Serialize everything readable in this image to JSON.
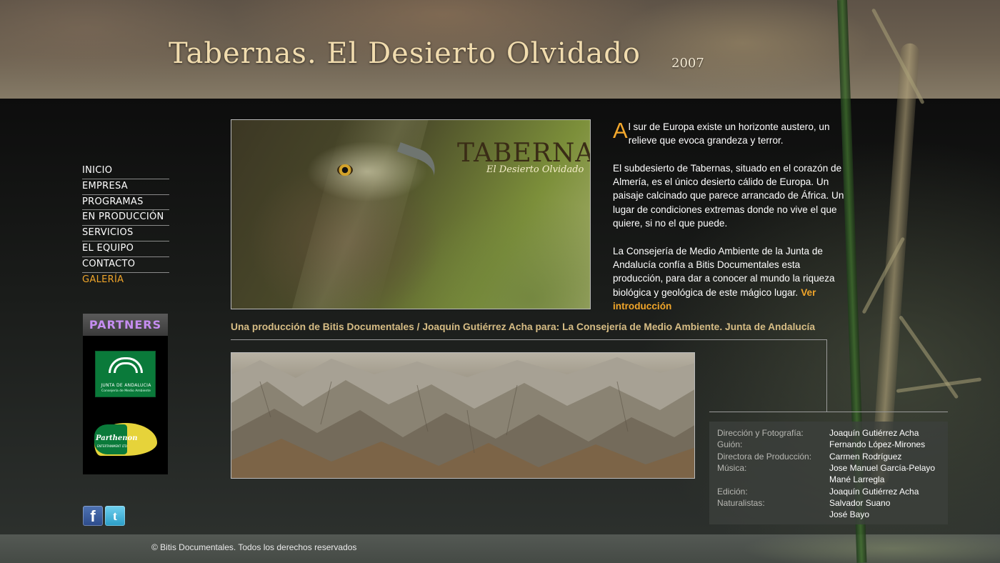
{
  "header": {
    "title": "Tabernas. El Desierto Olvidado",
    "year": "2007"
  },
  "nav": {
    "items": [
      {
        "label": "INICIO"
      },
      {
        "label": "EMPRESA"
      },
      {
        "label": "PROGRAMAS"
      },
      {
        "label": "EN PRODUCCIÓN"
      },
      {
        "label": "SERVICIOS"
      },
      {
        "label": "EL EQUIPO"
      },
      {
        "label": "CONTACTO"
      },
      {
        "label": "GALERÍA",
        "active": true
      }
    ],
    "active_color": "#f0a52a"
  },
  "partners": {
    "header": "PARTNERS",
    "logos": [
      {
        "name": "junta-de-andalucia",
        "text": "JUNTA DE ANDALUCIA",
        "subtext": "Consejería de Medio Ambiente"
      },
      {
        "name": "parthenon",
        "text": "Parthenon",
        "subtext": "ENTERTAINMENT LTD"
      }
    ]
  },
  "social": {
    "facebook": "f",
    "twitter": "t"
  },
  "eagle_image": {
    "title": "TABERNAS",
    "subtitle": "El Desierto Olvidado"
  },
  "intro": {
    "dropcap": "A",
    "p1": "l sur de Europa existe un horizonte austero, un relieve que evoca grandeza y terror.",
    "p2": "El subdesierto de Tabernas, situado en el corazón de Almería, es el único desierto cálido de Europa. Un paisaje calcinado que parece arrancado de África. Un lugar de condiciones extremas donde no vive el que quiere, si no el que puede.",
    "p3": "La Consejería de Medio Ambiente de la Junta de Andalucía confía a Bitis Documentales esta producción, para dar a conocer al mundo la riqueza biológica y geológica de este mágico lugar.",
    "link": "Ver introducción"
  },
  "production_credit": "Una producción de Bitis Documentales / Joaquín Gutiérrez Acha para: La Consejería de Medio Ambiente. Junta de Andalucía",
  "credits": [
    {
      "role": "Dirección y Fotografía:",
      "name": "Joaquín Gutiérrez Acha"
    },
    {
      "role": "Guión:",
      "name": "Fernando López-Mirones"
    },
    {
      "role": "Directora de Producción:",
      "name": "Carmen Rodríguez"
    },
    {
      "role": "Música:",
      "name": "Jose Manuel García-Pelayo"
    },
    {
      "role": "",
      "name": "Mané Larregla"
    },
    {
      "role": "Edición:",
      "name": "Joaquín Gutiérrez Acha"
    },
    {
      "role": "Naturalistas:",
      "name": "Salvador Suano"
    },
    {
      "role": "",
      "name": "José Bayo"
    }
  ],
  "footer": {
    "copyright": "© Bitis Documentales. Todos los derechos reservados"
  },
  "colors": {
    "title": "#f1dcae",
    "accent": "#f0a52a",
    "credit_line": "#d7bd85",
    "partners_header": "#c58df0"
  }
}
